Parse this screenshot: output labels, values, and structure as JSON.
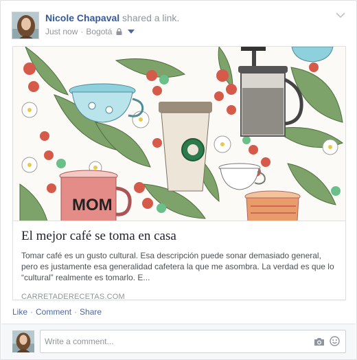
{
  "post": {
    "author": "Nicole Chapaval",
    "action": "shared a link.",
    "timestamp": "Just now",
    "location": "Bogotá",
    "privacy_icon": "lock-icon",
    "audience_icon": "caret-down-icon",
    "options_icon": "chevron-down-icon"
  },
  "link": {
    "image_mug_text": "MOM",
    "title": "El mejor café se toma en casa",
    "description": "Tomar café es un gusto cultural. Esa descripción puede sonar demasiado general, pero es justamente esa generalidad cafetera la que me asombra. La verdad es que lo “cultural” realmente es tomarlo. E...",
    "domain": "CARRETADERECETAS.COM"
  },
  "actions": {
    "like": "Like",
    "comment": "Comment",
    "share": "Share",
    "separator": "·"
  },
  "comment": {
    "placeholder": "Write a comment...",
    "camera_icon": "camera-icon",
    "emoji_icon": "emoji-icon"
  },
  "colors": {
    "link_blue": "#365899",
    "meta_gray": "#90949c",
    "background": "#e9ebee"
  }
}
